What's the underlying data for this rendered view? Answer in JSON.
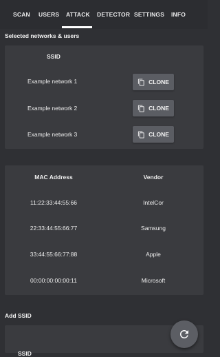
{
  "tabs": [
    {
      "label": "SCAN"
    },
    {
      "label": "USERS"
    },
    {
      "label": "ATTACK"
    },
    {
      "label": "DETECTOR"
    },
    {
      "label": "SETTINGS"
    },
    {
      "label": "INFO"
    }
  ],
  "active_tab": "ATTACK",
  "selected_section": {
    "title": "Selected networks & users",
    "ssid_header": "SSID",
    "clone_label": "CLONE",
    "networks": [
      "Example network 1",
      "Example network 2",
      "Example network 3"
    ]
  },
  "mac_table": {
    "mac_header": "MAC Address",
    "vendor_header": "Vendor",
    "rows": [
      {
        "mac": "11:22:33:44:55:66",
        "vendor": "IntelCor"
      },
      {
        "mac": "22:33:44:55:66:77",
        "vendor": "Samsung"
      },
      {
        "mac": "33:44:55:66:77:88",
        "vendor": "Apple"
      },
      {
        "mac": "00:00:00:00:00:11",
        "vendor": "Microsoft"
      }
    ]
  },
  "add_ssid": {
    "title": "Add SSID",
    "partial_label": "SSID"
  },
  "icons": {
    "clone": "copy-icon",
    "fab": "refresh-icon"
  },
  "colors": {
    "background": "#2f3034",
    "card": "#3a3b3f",
    "button": "#5b5d63",
    "text": "#ffffff"
  }
}
